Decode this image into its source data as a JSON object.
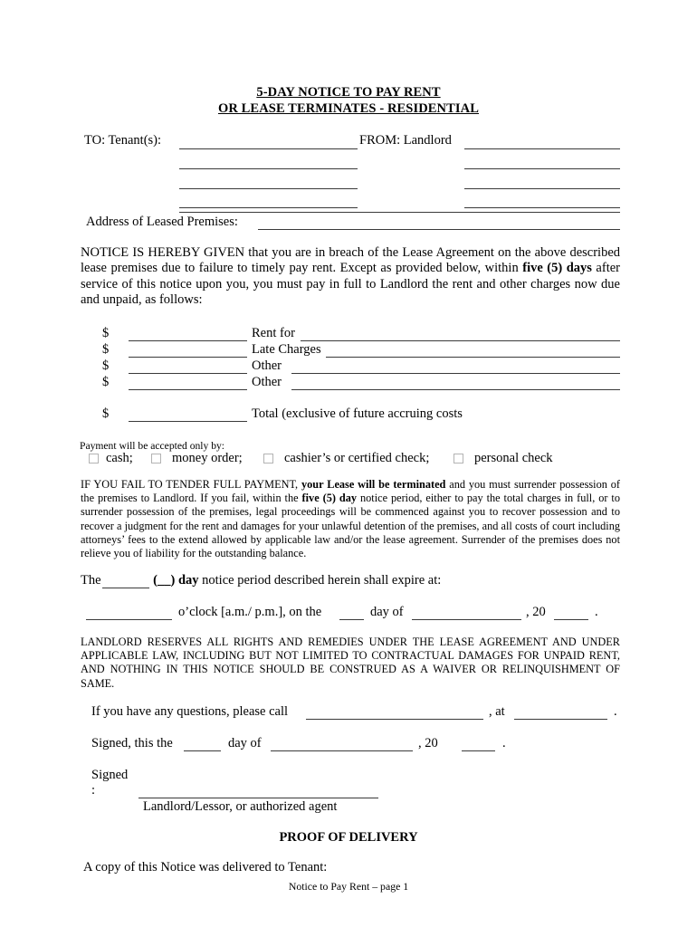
{
  "document": {
    "title_line_1": "5-DAY NOTICE TO PAY RENT",
    "title_line_2": "OR LEASE TERMINATES - RESIDENTIAL",
    "footer": "Notice to Pay Rent  – page 1"
  },
  "parties": {
    "to_label": "TO: Tenant(s):",
    "from_label": "FROM: Landlord",
    "address_label": "Address of Leased Premises:"
  },
  "notice": {
    "p1_a": "NOTICE IS HEREBY GIVEN that you are in breach of the Lease Agreement on the above described lease premises due to failure to timely pay rent.  Except as provided below, within ",
    "p1_bold": "five (5) days",
    "p1_b": " after service of this notice upon you, you must pay in full to Landlord the rent and other charges now due and unpaid, as follows:"
  },
  "charges": {
    "currency": "$",
    "rows": [
      {
        "label": "Rent for",
        "long_right": true
      },
      {
        "label": "Late Charges",
        "long_right": true
      },
      {
        "label": "Other",
        "long_right": false
      },
      {
        "label": "Other",
        "long_right": false
      }
    ],
    "total": {
      "currency": "$",
      "label": "Total (exclusive of future accruing costs"
    }
  },
  "payment": {
    "intro": "Payment will be accepted only by:",
    "options": [
      {
        "label": "cash;"
      },
      {
        "label": "money order;"
      },
      {
        "label": "cashier’s or certified check;"
      },
      {
        "label": "personal check"
      }
    ]
  },
  "failure": {
    "a": "IF YOU FAIL TO TENDER FULL PAYMENT, ",
    "bold_1": "your Lease will be terminated",
    "b": " and you must surrender possession of the premises to Landlord. If you fail, within the ",
    "bold_2": "five (5) day",
    "c": " notice period, either to pay the total charges in full, or to surrender possession of the premises, legal proceedings will be commenced against you to recover possession and to recover a judgment for the rent and damages for your unlawful detention of the premises, and all costs of court including attorneys’ fees to the extend allowed by applicable law and/or the lease agreement.  Surrender of the premises does not relieve you of liability for the outstanding balance."
  },
  "expiry": {
    "the": "The ",
    "bold_day": "(__) day",
    "rest": " notice period described herein shall expire at:",
    "oclock": "o’clock [a.m./ p.m.], on the",
    "day_of": "day of",
    "comma_20": ", 20",
    "period": "."
  },
  "reservation": {
    "text": "LANDLORD RESERVES ALL RIGHTS AND REMEDIES UNDER THE LEASE AGREEMENT AND UNDER APPLICABLE LAW, INCLUDING BUT NOT LIMITED TO CONTRACTUAL DAMAGES FOR UNPAID RENT, AND NOTHING IN THIS NOTICE SHOULD BE CONSTRUED AS A WAIVER OR RELINQUISHMENT OF SAME."
  },
  "signature": {
    "questions": "If you have any questions, please call",
    "comma_at": ", at",
    "period_1": ".",
    "signed_this": "Signed, this the",
    "day_of": "day of",
    "comma_20": ", 20",
    "period_2": ".",
    "signed_label": "Signed",
    "colon": ":",
    "signer_caption": "Landlord/Lessor, or authorized agent"
  },
  "delivery": {
    "heading": "PROOF OF DELIVERY",
    "line": "A copy of this Notice was delivered to Tenant:"
  }
}
